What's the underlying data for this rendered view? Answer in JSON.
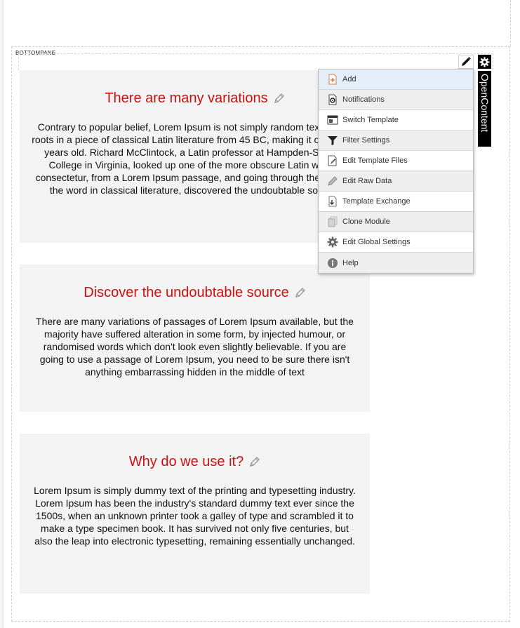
{
  "pane": {
    "label": "BOTTOMPANE"
  },
  "module": {
    "tab_label": "OpenContent"
  },
  "cards": [
    {
      "title": "There are many variations",
      "body": "Contrary to popular belief, Lorem Ipsum is not simply random text. It has roots in a piece of classical Latin literature from 45 BC, making it over 2000 years old. Richard McClintock, a Latin professor at Hampden-Sydney College in Virginia, looked up one of the more obscure Latin words, consectetur, from a Lorem Ipsum passage, and going through the cites of the word in classical literature, discovered the undoubtable source."
    },
    {
      "title": "Discover the undoubtable source",
      "body": "There are many variations of passages of Lorem Ipsum available, but the majority have suffered alteration in some form, by injected humour, or randomised words which don't look even slightly believable. If you are going to use a passage of Lorem Ipsum, you need to be sure there isn't anything embarrassing hidden in the middle of text"
    },
    {
      "title": "Why do we use it?",
      "body": "Lorem Ipsum is simply dummy text of the printing and typesetting industry. Lorem Ipsum has been the industry's standard dummy text ever since the 1500s, when an unknown printer took a galley of type and scrambled it to make a type specimen book. It has survived not only five centuries, but also the leap into electronic typesetting, remaining essentially unchanged."
    }
  ],
  "menu": {
    "items": [
      {
        "label": "Add",
        "icon": "add-document-icon"
      },
      {
        "label": "Notifications",
        "icon": "notifications-icon"
      },
      {
        "label": "Switch Template",
        "icon": "switch-template-icon"
      },
      {
        "label": "Filter Settings",
        "icon": "filter-icon"
      },
      {
        "label": "Edit Template Files",
        "icon": "edit-template-icon"
      },
      {
        "label": "Edit Raw Data",
        "icon": "pencil-icon"
      },
      {
        "label": "Template Exchange",
        "icon": "template-exchange-icon"
      },
      {
        "label": "Clone Module",
        "icon": "clone-icon"
      },
      {
        "label": "Edit Global Settings",
        "icon": "gear-icon"
      },
      {
        "label": "Help",
        "icon": "help-icon"
      }
    ]
  },
  "colors": {
    "title_red": "#cc1111",
    "card_bg": "#f3f3f3",
    "menu_highlight": "#e3eef8",
    "menu_alt": "#eeeeee"
  }
}
